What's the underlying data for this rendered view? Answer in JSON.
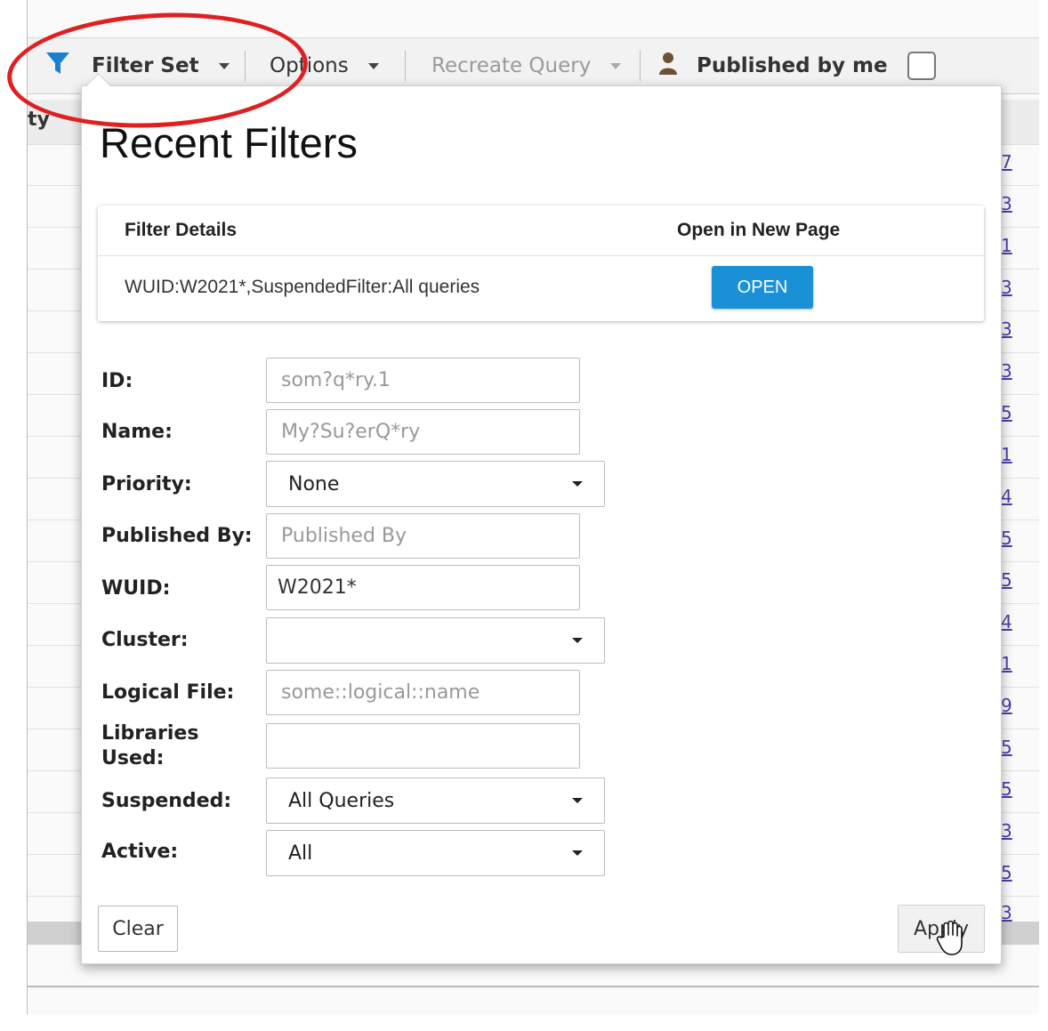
{
  "toolbar": {
    "filter_set": "Filter Set",
    "options": "Options",
    "recreate_query": "Recreate Query",
    "published_by_me": "Published by me"
  },
  "background": {
    "column_header_fragment": "ty",
    "right_links": [
      "7",
      "3",
      "1",
      "3",
      "3",
      "3",
      "5",
      "1",
      "4",
      "5",
      "5",
      "4",
      "1",
      "9",
      "5",
      "5",
      "3",
      "5",
      "3"
    ]
  },
  "panel": {
    "title": "Recent Filters",
    "recent": {
      "col_details": "Filter Details",
      "col_open": "Open in New Page",
      "row_value": "WUID:W2021*,SuspendedFilter:All queries",
      "open_label": "OPEN"
    },
    "fields": {
      "id": {
        "label": "ID:",
        "placeholder": "som?q*ry.1"
      },
      "name": {
        "label": "Name:",
        "placeholder": "My?Su?erQ*ry"
      },
      "priority": {
        "label": "Priority:",
        "value": "None"
      },
      "published_by": {
        "label": "Published By:",
        "placeholder": "Published By"
      },
      "wuid": {
        "label": "WUID:",
        "value": "W2021*"
      },
      "cluster": {
        "label": "Cluster:",
        "value": ""
      },
      "logical_file": {
        "label": "Logical File:",
        "placeholder": "some::logical::name"
      },
      "libraries_used": {
        "label_line1": "Libraries",
        "label_line2": "Used:",
        "value": ""
      },
      "suspended": {
        "label": "Suspended:",
        "value": "All Queries"
      },
      "active": {
        "label": "Active:",
        "value": "All"
      }
    },
    "clear_label": "Clear",
    "apply_label": "Apply"
  },
  "colors": {
    "accent_blue": "#1a91d6",
    "annotation_red": "#e02020",
    "funnel_blue": "#1a7fd0",
    "link_purple": "#4a3fb0"
  }
}
